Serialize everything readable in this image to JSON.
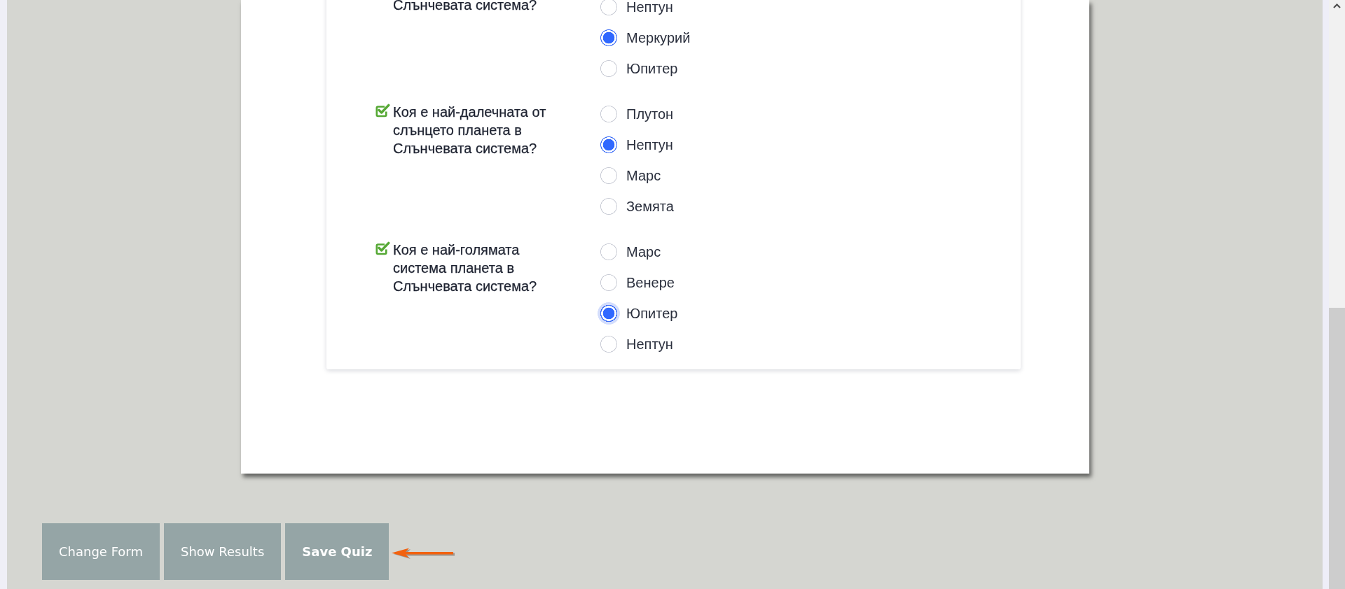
{
  "questions": [
    {
      "text": "Слънчевата система?",
      "check_mark": false,
      "options": [
        {
          "label": "Нептун",
          "selected": false,
          "focused": false
        },
        {
          "label": "Меркурий",
          "selected": true,
          "focused": false
        },
        {
          "label": "Юпитер",
          "selected": false,
          "focused": false
        }
      ]
    },
    {
      "text": "Коя е най-далечната от слънцето планета в Слънчевата система?",
      "check_mark": true,
      "options": [
        {
          "label": "Плутон",
          "selected": false,
          "focused": false
        },
        {
          "label": "Нептун",
          "selected": true,
          "focused": false
        },
        {
          "label": "Марс",
          "selected": false,
          "focused": false
        },
        {
          "label": "Земята",
          "selected": false,
          "focused": false
        }
      ]
    },
    {
      "text": "Коя е най-голямата система планета в Слънчевата система?",
      "check_mark": true,
      "options": [
        {
          "label": "Марс",
          "selected": false,
          "focused": false
        },
        {
          "label": "Венере",
          "selected": false,
          "focused": false
        },
        {
          "label": "Юпитер",
          "selected": true,
          "focused": true
        },
        {
          "label": "Нептун",
          "selected": false,
          "focused": false
        }
      ]
    }
  ],
  "buttons": [
    {
      "label": "Change Form",
      "primary": false
    },
    {
      "label": "Show Results",
      "primary": false
    },
    {
      "label": "Save Quiz",
      "primary": true
    }
  ]
}
